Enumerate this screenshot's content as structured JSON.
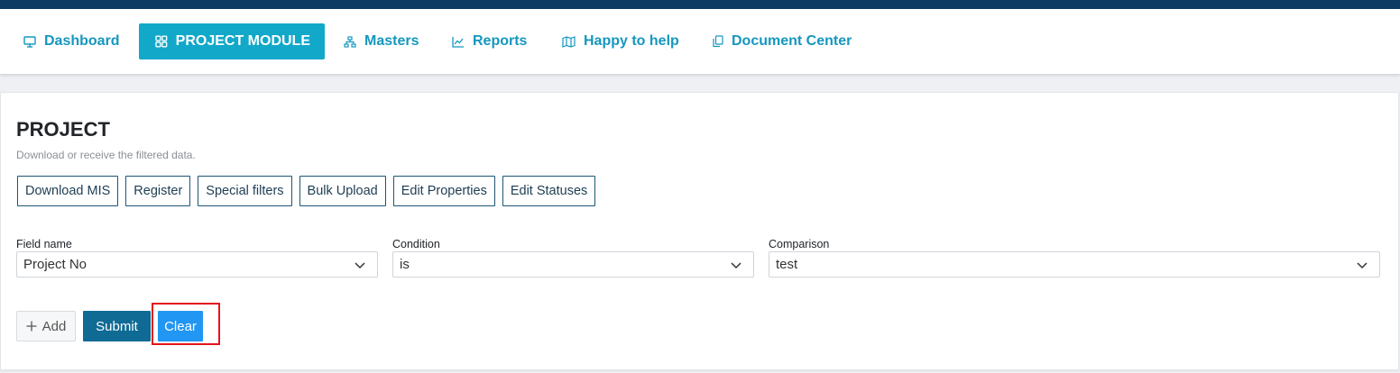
{
  "nav": {
    "items": [
      {
        "label": "Dashboard",
        "icon": "monitor-icon"
      },
      {
        "label": "PROJECT MODULE",
        "icon": "grid-icon",
        "active": true
      },
      {
        "label": "Masters",
        "icon": "sitemap-icon"
      },
      {
        "label": "Reports",
        "icon": "chart-icon"
      },
      {
        "label": "Happy to help",
        "icon": "map-icon"
      },
      {
        "label": "Document Center",
        "icon": "copy-icon"
      }
    ]
  },
  "page": {
    "title": "PROJECT",
    "subtitle": "Download or receive the filtered data."
  },
  "actions": [
    "Download MIS",
    "Register",
    "Special filters",
    "Bulk Upload",
    "Edit Properties",
    "Edit Statuses"
  ],
  "filters": {
    "field_name": {
      "label": "Field name",
      "value": "Project No"
    },
    "condition": {
      "label": "Condition",
      "value": "is"
    },
    "comparison": {
      "label": "Comparison",
      "value": "test"
    }
  },
  "buttons": {
    "add": "Add",
    "submit": "Submit",
    "clear": "Clear"
  },
  "colors": {
    "accent": "#12a8c9",
    "primary": "#0f6a94",
    "clear": "#2196f3",
    "highlight": "#e4141b",
    "topbar": "#0c3a63"
  }
}
